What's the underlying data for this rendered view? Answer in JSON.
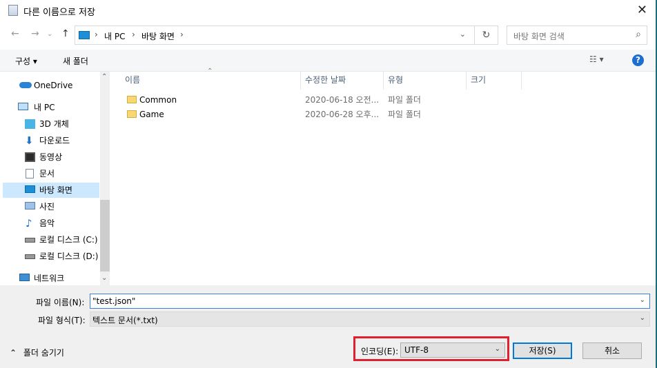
{
  "window": {
    "title": "다른 이름으로 저장"
  },
  "address": {
    "path": [
      "내 PC",
      "바탕 화면"
    ]
  },
  "search": {
    "placeholder": "바탕 화면 검색"
  },
  "toolbar": {
    "organize": "구성 ▾",
    "new_folder": "새 폴더",
    "view": "☷ ▾",
    "help": "?"
  },
  "sidebar": {
    "items": [
      {
        "label": "OneDrive"
      },
      {
        "label": "내 PC"
      },
      {
        "label": "3D 개체"
      },
      {
        "label": "다운로드"
      },
      {
        "label": "동영상"
      },
      {
        "label": "문서"
      },
      {
        "label": "바탕 화면"
      },
      {
        "label": "사진"
      },
      {
        "label": "음악"
      },
      {
        "label": "로컬 디스크 (C:)"
      },
      {
        "label": "로컬 디스크 (D:)"
      },
      {
        "label": "네트워크"
      }
    ]
  },
  "columns": {
    "name": "이름",
    "modified": "수정한 날짜",
    "type": "유형",
    "size": "크기"
  },
  "files": [
    {
      "name": "Common",
      "modified": "2020-06-18 오전...",
      "type": "파일 폴더"
    },
    {
      "name": "Game",
      "modified": "2020-06-28 오후...",
      "type": "파일 폴더"
    }
  ],
  "save": {
    "filename_label": "파일 이름(N):",
    "filename_value": "\"test.json\"",
    "filetype_label": "파일 형식(T):",
    "filetype_value": "텍스트 문서(*.txt)",
    "hide_folders": "폴더 숨기기",
    "encoding_label": "인코딩(E):",
    "encoding_value": "UTF-8",
    "save_button": "저장(S)",
    "cancel_button": "취소"
  },
  "colors": {
    "accent": "#0078d7",
    "highlight": "#e02030",
    "selected": "#cce8ff"
  }
}
